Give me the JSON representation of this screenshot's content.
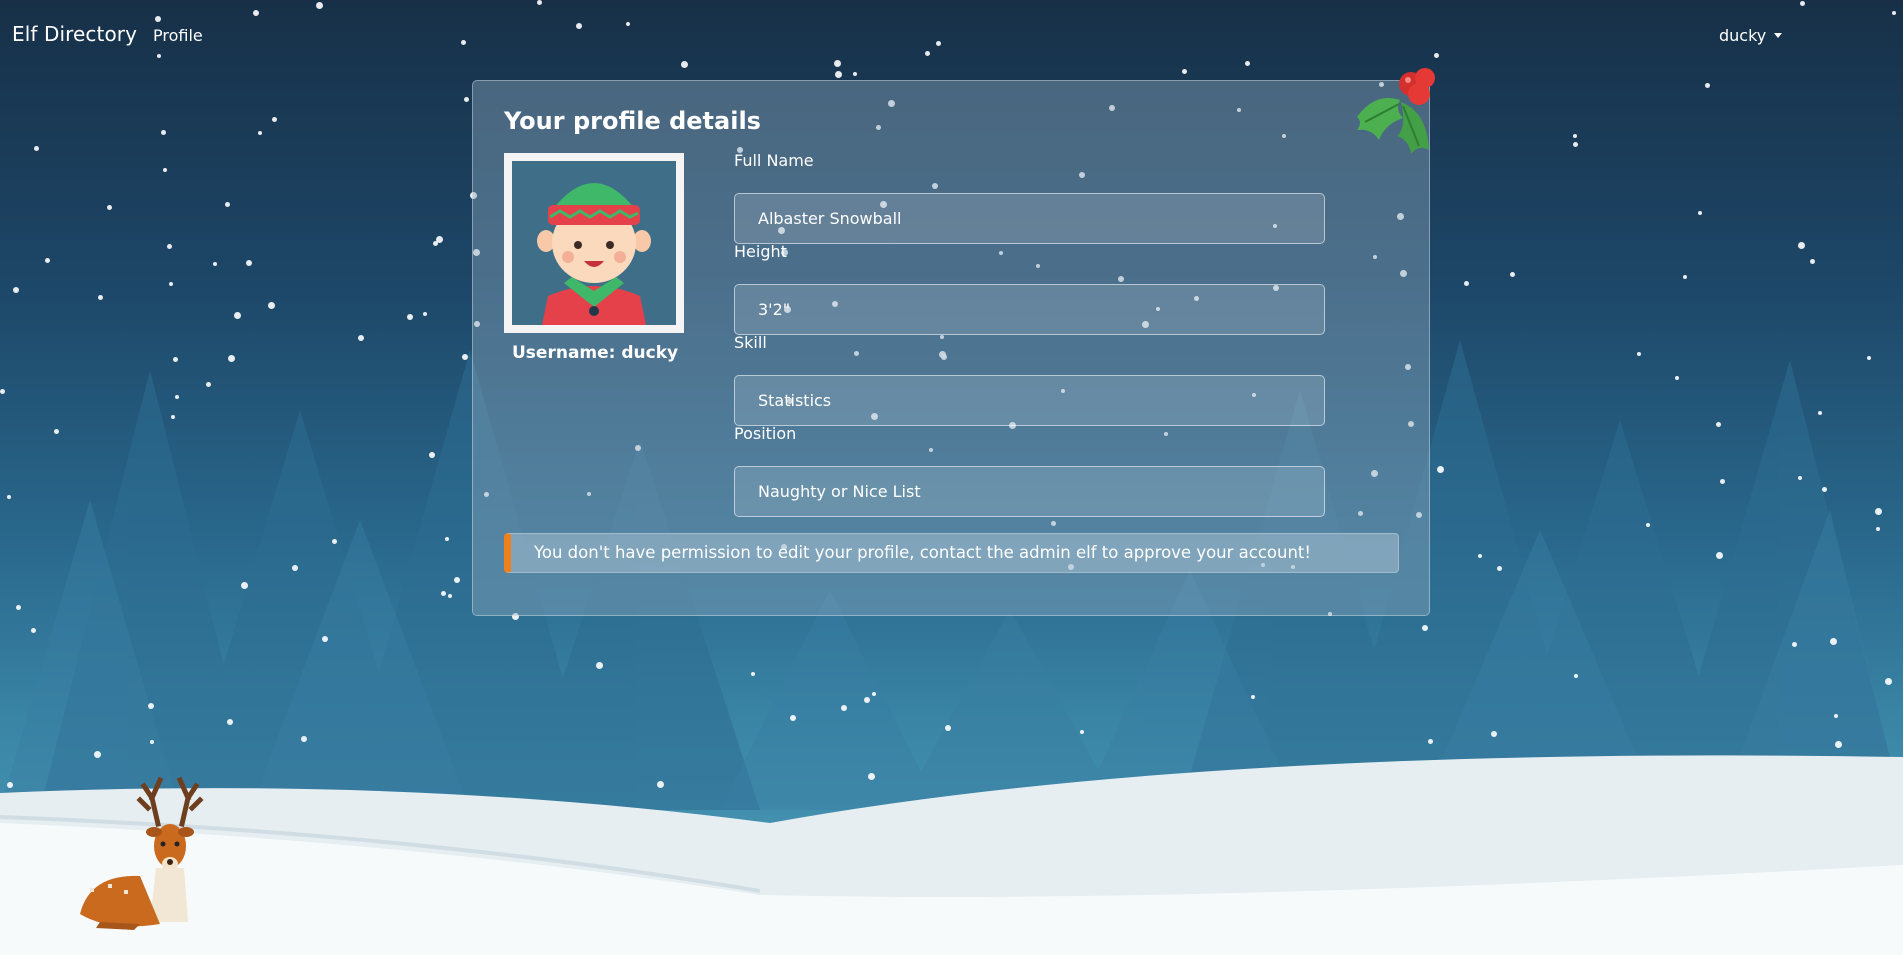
{
  "navbar": {
    "brand": "Elf Directory",
    "profile_link": "Profile",
    "user_menu": "ducky"
  },
  "card": {
    "title": "Your profile details",
    "username_label": "Username: ducky",
    "fields": [
      {
        "label": "Full Name",
        "value": "Albaster Snowball"
      },
      {
        "label": "Height",
        "value": "3'2\""
      },
      {
        "label": "Skill",
        "value": "Statistics"
      },
      {
        "label": "Position",
        "value": "Naughty or Nice List"
      }
    ],
    "alert": "You don't have permission to edit your profile, contact the admin elf to approve your account!"
  },
  "decorations": {
    "avatar": "elf-avatar-icon",
    "holly": "holly-icon",
    "reindeer": "reindeer-icon",
    "alert_accent_color": "#f07f1d"
  }
}
